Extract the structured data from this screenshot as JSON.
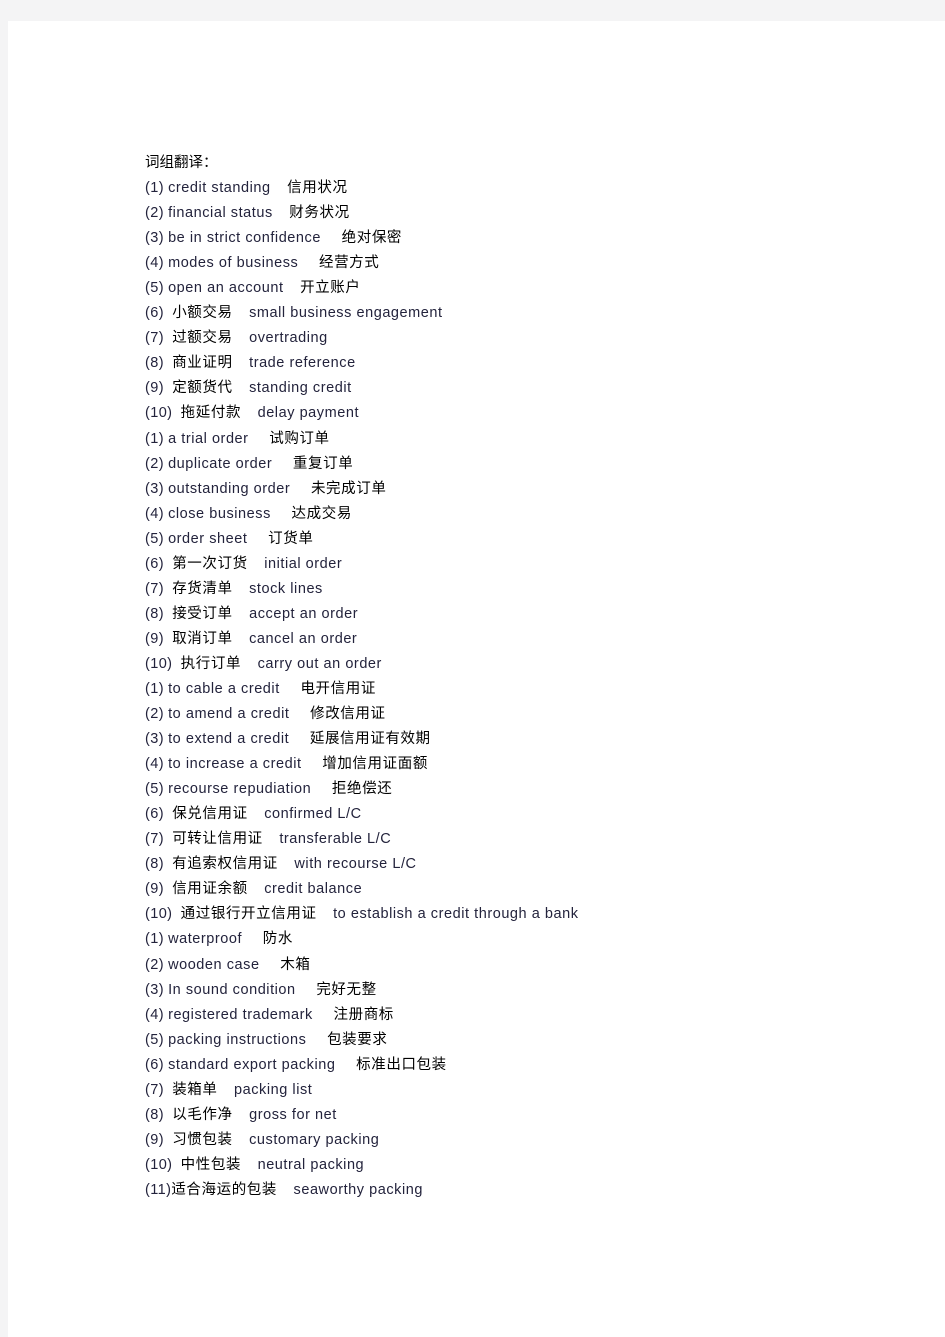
{
  "document": {
    "heading": "词组翻译：",
    "lines": [
      {
        "num": "(1)",
        "gap": " ",
        "first": "credit standing",
        "first_lang": "en",
        "sep": "    ",
        "second": "信用状况",
        "second_lang": "zh"
      },
      {
        "num": "(2)",
        "gap": " ",
        "first": "financial status",
        "first_lang": "en",
        "sep": "    ",
        "second": "财务状况",
        "second_lang": "zh"
      },
      {
        "num": "(3)",
        "gap": " ",
        "first": "be in strict confidence",
        "first_lang": "en",
        "sep": "     ",
        "second": "绝对保密",
        "second_lang": "zh"
      },
      {
        "num": "(4)",
        "gap": " ",
        "first": "modes of business",
        "first_lang": "en",
        "sep": "     ",
        "second": "经营方式",
        "second_lang": "zh"
      },
      {
        "num": "(5)",
        "gap": " ",
        "first": "open an account",
        "first_lang": "en",
        "sep": "    ",
        "second": "开立账户",
        "second_lang": "zh"
      },
      {
        "num": "(6)",
        "gap": "  ",
        "first": "小额交易",
        "first_lang": "zh",
        "sep": "    ",
        "second": "small business engagement",
        "second_lang": "en"
      },
      {
        "num": "(7)",
        "gap": "  ",
        "first": "过额交易",
        "first_lang": "zh",
        "sep": "    ",
        "second": "overtrading",
        "second_lang": "en"
      },
      {
        "num": "(8)",
        "gap": "  ",
        "first": "商业证明",
        "first_lang": "zh",
        "sep": "    ",
        "second": "trade reference",
        "second_lang": "en"
      },
      {
        "num": "(9)",
        "gap": "  ",
        "first": "定额货代",
        "first_lang": "zh",
        "sep": "    ",
        "second": "standing credit",
        "second_lang": "en"
      },
      {
        "num": "(10)",
        "gap": "  ",
        "first": "拖延付款",
        "first_lang": "zh",
        "sep": "    ",
        "second": "delay payment",
        "second_lang": "en"
      },
      {
        "num": "(1)",
        "gap": " ",
        "first": "a trial order",
        "first_lang": "en",
        "sep": "     ",
        "second": "试购订单",
        "second_lang": "zh"
      },
      {
        "num": "(2)",
        "gap": " ",
        "first": "duplicate order",
        "first_lang": "en",
        "sep": "     ",
        "second": "重复订单",
        "second_lang": "zh"
      },
      {
        "num": "(3)",
        "gap": " ",
        "first": "outstanding order",
        "first_lang": "en",
        "sep": "     ",
        "second": "未完成订单",
        "second_lang": "zh"
      },
      {
        "num": "(4)",
        "gap": " ",
        "first": "close business",
        "first_lang": "en",
        "sep": "     ",
        "second": "达成交易",
        "second_lang": "zh"
      },
      {
        "num": "(5)",
        "gap": " ",
        "first": "order sheet",
        "first_lang": "en",
        "sep": "     ",
        "second": "订货单",
        "second_lang": "zh"
      },
      {
        "num": "(6)",
        "gap": "  ",
        "first": "第一次订货",
        "first_lang": "zh",
        "sep": "    ",
        "second": "initial order",
        "second_lang": "en"
      },
      {
        "num": "(7)",
        "gap": "  ",
        "first": "存货清单",
        "first_lang": "zh",
        "sep": "    ",
        "second": "stock lines",
        "second_lang": "en"
      },
      {
        "num": "(8)",
        "gap": "  ",
        "first": "接受订单",
        "first_lang": "zh",
        "sep": "    ",
        "second": "accept an order",
        "second_lang": "en"
      },
      {
        "num": "(9)",
        "gap": "  ",
        "first": "取消订单",
        "first_lang": "zh",
        "sep": "    ",
        "second": "cancel an order",
        "second_lang": "en"
      },
      {
        "num": "(10)",
        "gap": "  ",
        "first": "执行订单",
        "first_lang": "zh",
        "sep": "    ",
        "second": "carry out an order",
        "second_lang": "en"
      },
      {
        "num": "(1)",
        "gap": " ",
        "first": "to cable a credit",
        "first_lang": "en",
        "sep": "     ",
        "second": "电开信用证",
        "second_lang": "zh"
      },
      {
        "num": "(2)",
        "gap": " ",
        "first": "to amend a credit",
        "first_lang": "en",
        "sep": "     ",
        "second": "修改信用证",
        "second_lang": "zh"
      },
      {
        "num": "(3)",
        "gap": " ",
        "first": "to extend a credit",
        "first_lang": "en",
        "sep": "     ",
        "second": "延展信用证有效期",
        "second_lang": "zh"
      },
      {
        "num": "(4)",
        "gap": " ",
        "first": "to increase a credit",
        "first_lang": "en",
        "sep": "     ",
        "second": "增加信用证面额",
        "second_lang": "zh"
      },
      {
        "num": "(5)",
        "gap": " ",
        "first": "recourse repudiation",
        "first_lang": "en",
        "sep": "     ",
        "second": "拒绝偿还",
        "second_lang": "zh"
      },
      {
        "num": "(6)",
        "gap": "  ",
        "first": "保兑信用证",
        "first_lang": "zh",
        "sep": "    ",
        "second": "confirmed L/C",
        "second_lang": "en"
      },
      {
        "num": "(7)",
        "gap": "  ",
        "first": "可转让信用证",
        "first_lang": "zh",
        "sep": "    ",
        "second": "transferable L/C",
        "second_lang": "en"
      },
      {
        "num": "(8)",
        "gap": "  ",
        "first": "有追索权信用证",
        "first_lang": "zh",
        "sep": "    ",
        "second": "with recourse L/C",
        "second_lang": "en"
      },
      {
        "num": "(9)",
        "gap": "  ",
        "first": "信用证余额",
        "first_lang": "zh",
        "sep": "    ",
        "second": "credit balance",
        "second_lang": "en"
      },
      {
        "num": "(10)",
        "gap": "  ",
        "first": "通过银行开立信用证",
        "first_lang": "zh",
        "sep": "    ",
        "second": "to establish a credit through a bank",
        "second_lang": "en"
      },
      {
        "num": "(1)",
        "gap": " ",
        "first": "waterproof",
        "first_lang": "en",
        "sep": "     ",
        "second": "防水",
        "second_lang": "zh"
      },
      {
        "num": "(2)",
        "gap": " ",
        "first": "wooden case",
        "first_lang": "en",
        "sep": "     ",
        "second": "木箱",
        "second_lang": "zh"
      },
      {
        "num": "(3)",
        "gap": " ",
        "first": "In sound condition",
        "first_lang": "en",
        "sep": "     ",
        "second": "完好无整",
        "second_lang": "zh"
      },
      {
        "num": "(4)",
        "gap": " ",
        "first": "registered trademark",
        "first_lang": "en",
        "sep": "     ",
        "second": "注册商标",
        "second_lang": "zh"
      },
      {
        "num": "(5)",
        "gap": " ",
        "first": "packing instructions",
        "first_lang": "en",
        "sep": "     ",
        "second": "包装要求",
        "second_lang": "zh"
      },
      {
        "num": "(6)",
        "gap": " ",
        "first": "standard export packing",
        "first_lang": "en",
        "sep": "     ",
        "second": "标准出口包装",
        "second_lang": "zh"
      },
      {
        "num": "(7)",
        "gap": "  ",
        "first": "装箱单",
        "first_lang": "zh",
        "sep": "    ",
        "second": "packing list",
        "second_lang": "en"
      },
      {
        "num": "(8)",
        "gap": "  ",
        "first": "以毛作净",
        "first_lang": "zh",
        "sep": "    ",
        "second": "gross for net",
        "second_lang": "en"
      },
      {
        "num": "(9)",
        "gap": "  ",
        "first": "习惯包装",
        "first_lang": "zh",
        "sep": "    ",
        "second": "customary packing",
        "second_lang": "en"
      },
      {
        "num": "(10)",
        "gap": "  ",
        "first": "中性包装",
        "first_lang": "zh",
        "sep": "    ",
        "second": "neutral packing",
        "second_lang": "en"
      },
      {
        "num": "(11)",
        "gap": "",
        "first": "适合海运的包装",
        "first_lang": "zh",
        "sep": "    ",
        "second": "seaworthy packing",
        "second_lang": "en"
      }
    ]
  }
}
